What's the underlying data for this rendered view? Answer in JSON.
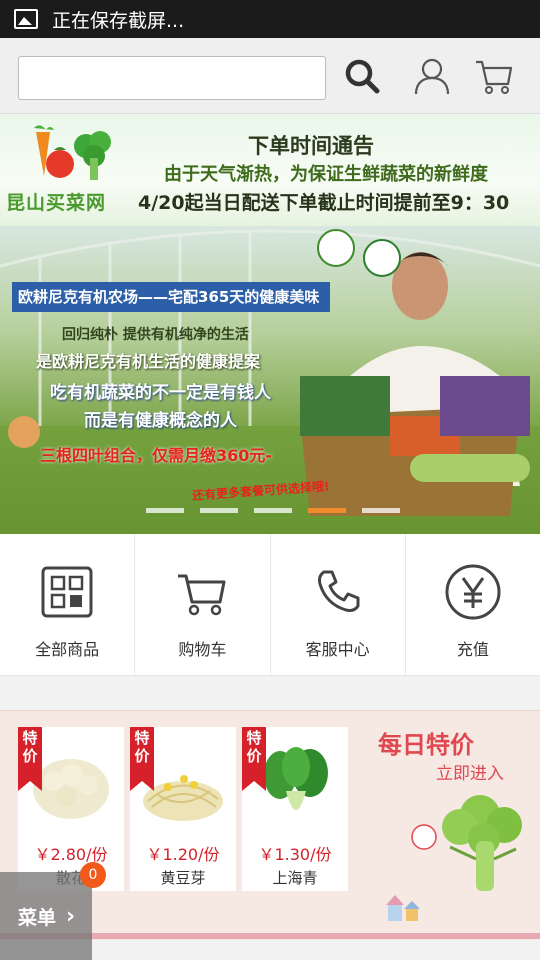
{
  "status_bar": {
    "text": "正在保存截屏..."
  },
  "search": {
    "value": "",
    "placeholder": ""
  },
  "notice": {
    "logo_text": "昆山买菜网",
    "title": "下单时间通告",
    "line1": "由于天气渐热，为保证生鲜蔬菜的新鲜度",
    "line2": "4/20起当日配送下单截止时间提前至9：30"
  },
  "banner": {
    "title": "欧耕尼克有机农场——宅配365天的健康美味",
    "line2": "回归纯朴 提供有机纯净的生活",
    "line3": "是欧耕尼克有机生活的健康提案",
    "line4": "吃有机蔬菜的不一定是有钱人",
    "line5": "而是有健康概念的人",
    "line6": "三根四叶组合，仅需月缴360元-",
    "line7": "还有更多套餐可供选择哦!",
    "active_slide": 4,
    "slide_count": 5
  },
  "quick_nav": [
    {
      "label": "全部商品",
      "icon": "grid-icon"
    },
    {
      "label": "购物车",
      "icon": "cart-icon"
    },
    {
      "label": "客服中心",
      "icon": "phone-icon"
    },
    {
      "label": "充值",
      "icon": "yen-icon"
    }
  ],
  "daily_deals": {
    "title": "每日特价",
    "enter": "立即进入",
    "tag": "特价",
    "items": [
      {
        "price": "￥2.80/份",
        "name": "散花"
      },
      {
        "price": "￥1.20/份",
        "name": "黄豆芽"
      },
      {
        "price": "￥1.30/份",
        "name": "上海青"
      }
    ]
  },
  "menu": {
    "label": "菜单",
    "badge": "0"
  },
  "colors": {
    "accent_red": "#d6202a",
    "deal_pink": "#e1474f",
    "banner_blue": "#2d5fa8"
  }
}
